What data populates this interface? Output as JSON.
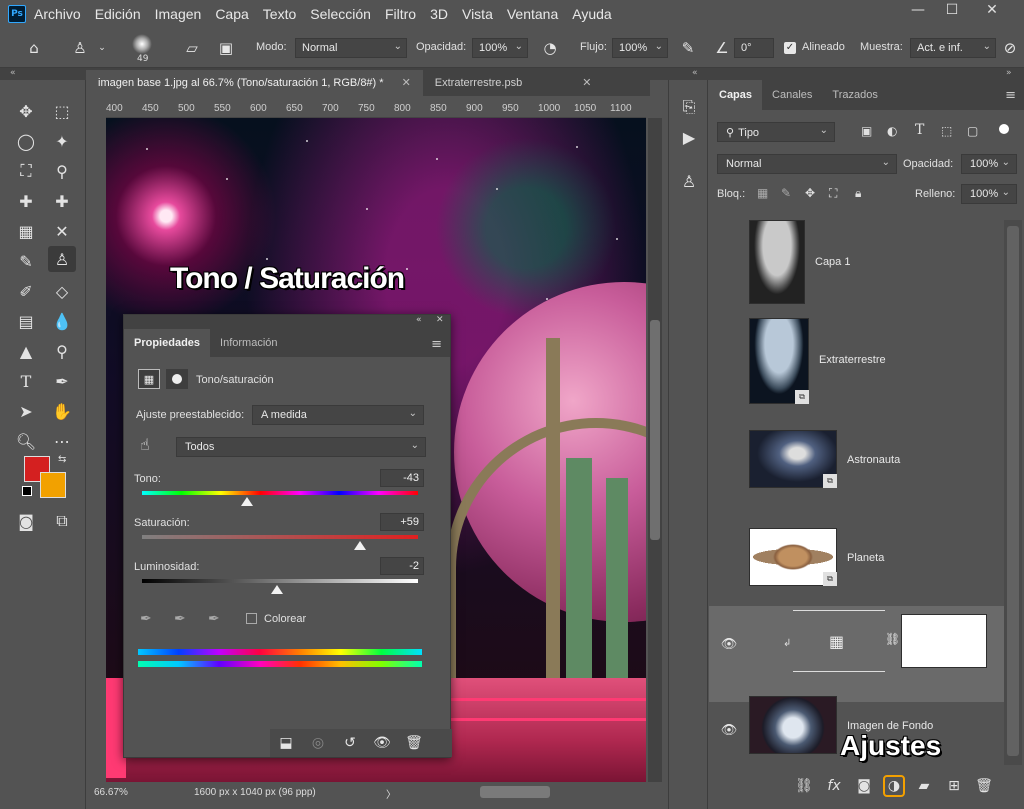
{
  "app": {
    "logo": "Ps"
  },
  "menu": [
    "Archivo",
    "Edición",
    "Imagen",
    "Capa",
    "Texto",
    "Selección",
    "Filtro",
    "3D",
    "Vista",
    "Ventana",
    "Ayuda"
  ],
  "window_controls": {
    "minimize": "—",
    "maximize": "☐",
    "close": "✕"
  },
  "options_bar": {
    "brush_size": "49",
    "mode_label": "Modo:",
    "mode_value": "Normal",
    "opacity_label": "Opacidad:",
    "opacity_value": "100%",
    "flow_label": "Flujo:",
    "flow_value": "100%",
    "angle_value": "0°",
    "aligned_label": "Alineado",
    "sample_label": "Muestra:",
    "sample_value": "Act. e inf."
  },
  "collapse_arrows": {
    "left": "«",
    "right": "»"
  },
  "document_tabs": [
    {
      "label": "imagen base 1.jpg al 66.7% (Tono/saturación 1, RGB/8#) *",
      "close": "✕"
    },
    {
      "label": "Extraterrestre.psb",
      "close": "✕"
    }
  ],
  "ruler_ticks": [
    "400",
    "450",
    "500",
    "550",
    "600",
    "650",
    "700",
    "750",
    "800",
    "850",
    "900",
    "950",
    "1000",
    "1050",
    "1100"
  ],
  "canvas_overlay_title": "Tono / Saturación",
  "status": {
    "zoom": "66.67%",
    "doc_size": "1600 px x 1040 px (96 ppp)",
    "arrow": "〉"
  },
  "properties": {
    "tab_active": "Propiedades",
    "tab_other": "Información",
    "menu_icon": "≡",
    "adjustment_title": "Tono/saturación",
    "preset_label": "Ajuste preestablecido:",
    "preset_value": "A medida",
    "channel_value": "Todos",
    "hue_label": "Tono:",
    "hue_value": "-43",
    "hue_position": 0.38,
    "sat_label": "Saturación:",
    "sat_value": "+59",
    "sat_position": 0.79,
    "light_label": "Luminosidad:",
    "light_value": "-2",
    "light_position": 0.49,
    "colorize_label": "Colorear"
  },
  "layers_panel": {
    "tabs": [
      "Capas",
      "Canales",
      "Trazados"
    ],
    "filter_value": "Tipo",
    "blend_value": "Normal",
    "opacity_label": "Opacidad:",
    "opacity_value": "100%",
    "lock_label": "Bloq.:",
    "fill_label": "Relleno:",
    "fill_value": "100%",
    "layers": [
      {
        "name": "Capa 1",
        "visible": false
      },
      {
        "name": "Extraterrestre",
        "visible": false
      },
      {
        "name": "Astronauta",
        "visible": false
      },
      {
        "name": "Planeta",
        "visible": false
      },
      {
        "name": "",
        "visible": true,
        "selected": true
      },
      {
        "name": "Imagen de Fondo",
        "visible": true
      }
    ]
  },
  "annotation_ajustes": "Ajustes",
  "colors": {
    "foreground": "#d42020",
    "background": "#f2a100",
    "ui_dark": "#424242",
    "ui_mid": "#535353",
    "accent_blue": "#31a8ff"
  }
}
